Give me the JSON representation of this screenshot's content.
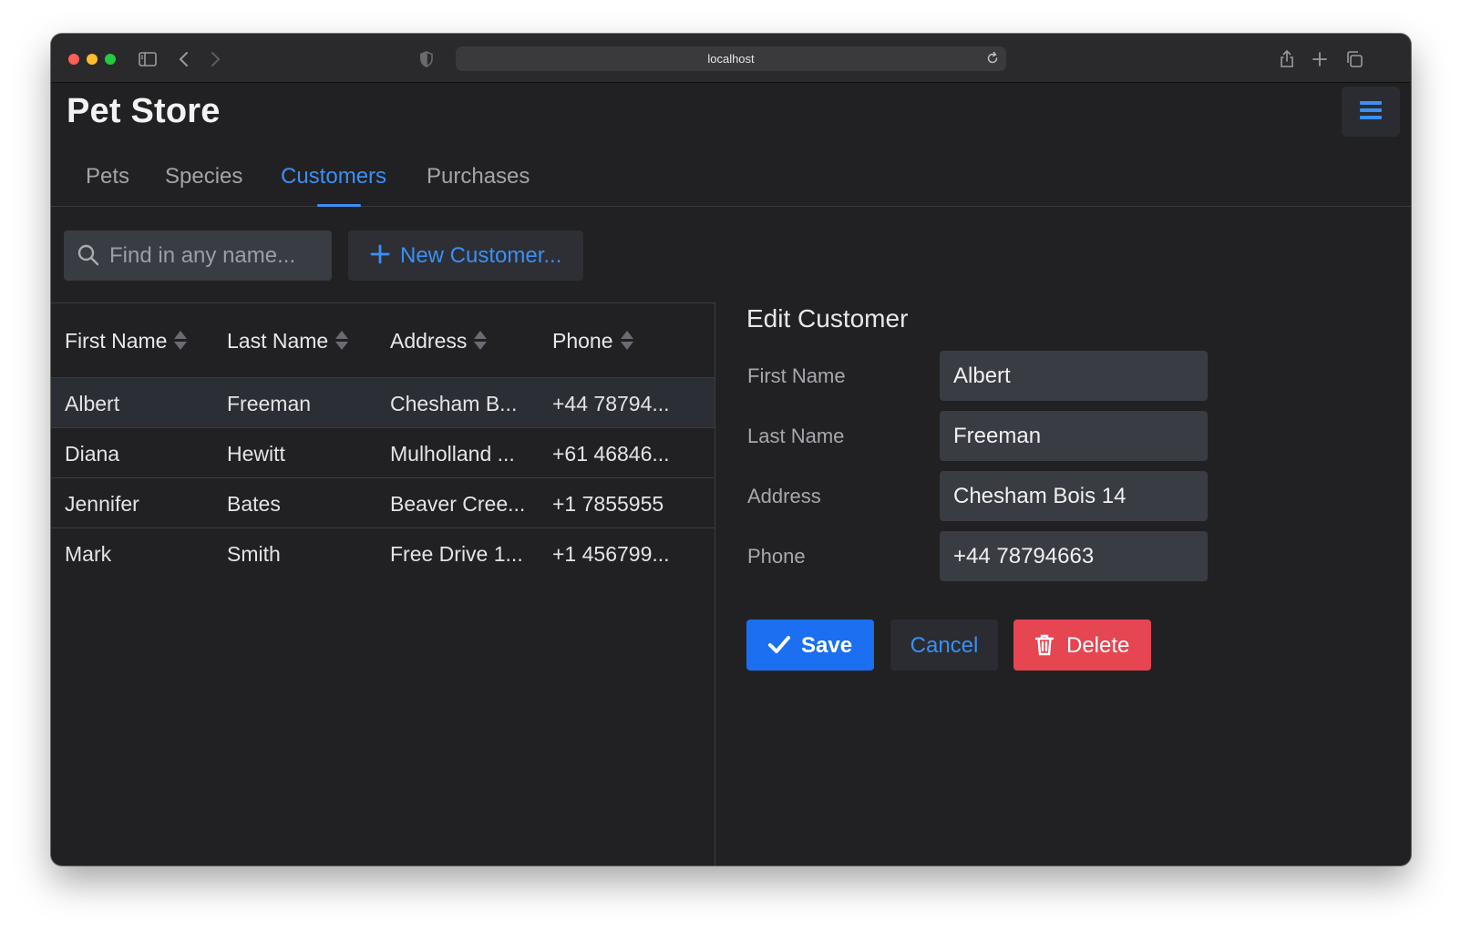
{
  "browser": {
    "url": "localhost"
  },
  "app": {
    "title": "Pet Store",
    "accent_color": "#3b8ff5"
  },
  "tabs": [
    {
      "label": "Pets",
      "active": false
    },
    {
      "label": "Species",
      "active": false
    },
    {
      "label": "Customers",
      "active": true
    },
    {
      "label": "Purchases",
      "active": false
    }
  ],
  "toolbar": {
    "search_placeholder": "Find in any name...",
    "new_label": "New Customer..."
  },
  "table": {
    "columns": [
      "First Name",
      "Last Name",
      "Address",
      "Phone"
    ],
    "rows": [
      [
        "Albert",
        "Freeman",
        "Chesham B...",
        "+44 78794..."
      ],
      [
        "Diana",
        "Hewitt",
        "Mulholland ...",
        "+61 46846..."
      ],
      [
        "Jennifer",
        "Bates",
        "Beaver Cree...",
        "+1 7855955"
      ],
      [
        "Mark",
        "Smith",
        "Free Drive 1...",
        "+1 456799..."
      ]
    ],
    "selected_row": 0
  },
  "form": {
    "title": "Edit Customer",
    "fields": [
      {
        "label": "First Name",
        "value": "Albert"
      },
      {
        "label": "Last Name",
        "value": "Freeman"
      },
      {
        "label": "Address",
        "value": "Chesham Bois 14"
      },
      {
        "label": "Phone",
        "value": "+44 78794663"
      }
    ],
    "save_label": "Save",
    "cancel_label": "Cancel",
    "delete_label": "Delete",
    "save_color": "#1b6ff0",
    "delete_color": "#e64552"
  }
}
